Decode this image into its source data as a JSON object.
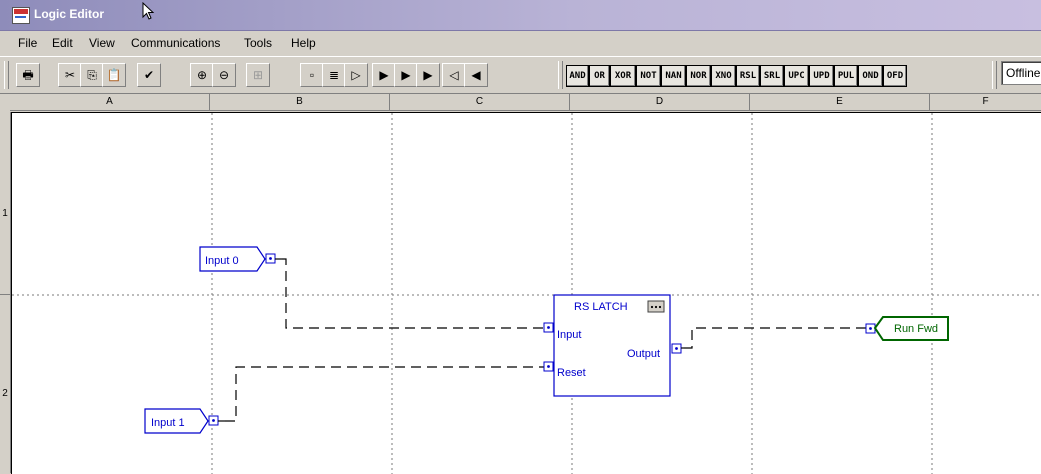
{
  "window": {
    "title": "Logic Editor"
  },
  "menu": [
    "File",
    "Edit",
    "View",
    "Communications",
    "Tools",
    "Help"
  ],
  "toolbar": {
    "buttons": [
      {
        "name": "print-button",
        "icon": "printer-icon",
        "glyph": "🖶"
      },
      {
        "name": "cut-button",
        "icon": "scissors-icon",
        "glyph": "✂"
      },
      {
        "name": "copy-button",
        "icon": "copy-icon",
        "glyph": "⎘"
      },
      {
        "name": "paste-button",
        "icon": "paste-icon",
        "glyph": "📋",
        "disabled": true
      },
      {
        "name": "verify-button",
        "icon": "check-icon",
        "glyph": "✔"
      },
      {
        "name": "zoom-in-button",
        "icon": "zoom-in-icon",
        "glyph": "⊕"
      },
      {
        "name": "zoom-out-button",
        "icon": "zoom-out-icon",
        "glyph": "⊖"
      },
      {
        "name": "edit-lock-button",
        "icon": "lock-icon",
        "glyph": "⊞",
        "disabled": true
      },
      {
        "name": "block-button",
        "icon": "block-icon",
        "glyph": "▫"
      },
      {
        "name": "list-button",
        "icon": "list-icon",
        "glyph": "≣"
      },
      {
        "name": "input-tag-button",
        "icon": "input-tag-icon",
        "glyph": "▷"
      },
      {
        "name": "net-button",
        "icon": "net-icon",
        "glyph": "▶"
      },
      {
        "name": "fault-button",
        "icon": "fault-icon",
        "glyph": "▶"
      },
      {
        "name": "status-button",
        "icon": "status-icon",
        "glyph": "▶"
      },
      {
        "name": "output-tag-button",
        "icon": "output-tag-icon",
        "glyph": "◁"
      },
      {
        "name": "net-out-button",
        "icon": "net-out-icon",
        "glyph": "◀"
      }
    ],
    "instructions": [
      "AND",
      "OR",
      "XOR",
      "NOT",
      "NAN",
      "NOR",
      "XNO",
      "RSL",
      "SRL",
      "UPC",
      "UPD",
      "PUL",
      "OND",
      "OFD"
    ],
    "status": "Offline"
  },
  "columns": [
    "A",
    "B",
    "C",
    "D",
    "E",
    "F"
  ],
  "rows": [
    "1",
    "2"
  ],
  "diagram": {
    "inputs": [
      {
        "label": "Input 0"
      },
      {
        "label": "Input 1"
      }
    ],
    "block": {
      "title": "RS LATCH",
      "menu_icon": "ellipsis-icon",
      "pins_in": [
        "Input",
        "Reset"
      ],
      "pins_out": [
        "Output"
      ]
    },
    "outputs": [
      {
        "label": "Run Fwd",
        "color": "#006600"
      }
    ],
    "wire_color": "#000000",
    "element_color": "#0000cc"
  }
}
